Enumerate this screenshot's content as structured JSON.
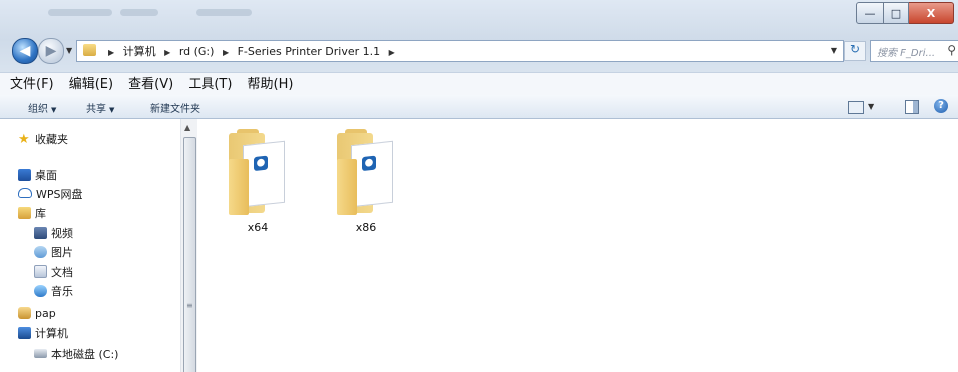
{
  "window": {
    "buttons": {
      "minimize": "—",
      "maximize": "□",
      "close": "X"
    }
  },
  "address": {
    "crumbs": [
      "计算机",
      "rd (G:)",
      "F-Series Printer Driver 1.1"
    ],
    "search_placeholder": "搜索 F_Dri..."
  },
  "menu": [
    "文件(F)",
    "编辑(E)",
    "查看(V)",
    "工具(T)",
    "帮助(H)"
  ],
  "toolbar": {
    "organize": "组织",
    "share": "共享",
    "new_folder": "新建文件夹",
    "help": "?"
  },
  "nav_tree": [
    {
      "label": "收藏夹",
      "icon": "star-icon"
    },
    {
      "label": "桌面",
      "icon": "desktop-icon"
    },
    {
      "label": "WPS网盘",
      "icon": "cloud-icon"
    },
    {
      "label": "库",
      "icon": "library-icon"
    },
    {
      "label": "视频",
      "icon": "video-icon"
    },
    {
      "label": "图片",
      "icon": "pictures-icon"
    },
    {
      "label": "文档",
      "icon": "documents-icon"
    },
    {
      "label": "音乐",
      "icon": "music-icon"
    },
    {
      "label": "pap",
      "icon": "user-folder-icon"
    },
    {
      "label": "计算机",
      "icon": "computer-icon"
    },
    {
      "label": "本地磁盘 (C:)",
      "icon": "drive-icon"
    }
  ],
  "files": [
    {
      "name": "x64",
      "type": "folder"
    },
    {
      "name": "x86",
      "type": "folder"
    }
  ]
}
